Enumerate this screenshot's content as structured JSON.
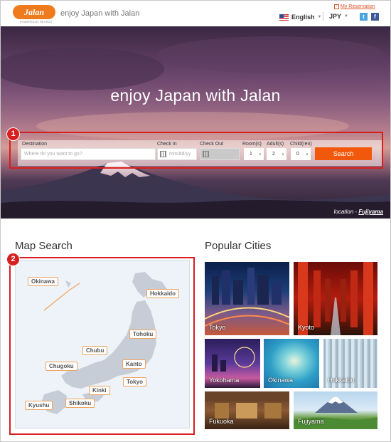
{
  "header": {
    "logo_text": "Jalan",
    "logo_sub": "POWERED BY RECRUIT",
    "tagline": "enjoy Japan with Jalan",
    "my_reservation": "My Reservation",
    "language": "English",
    "currency": "JPY",
    "social": {
      "twitter": "t",
      "facebook": "f"
    }
  },
  "hero": {
    "title": "enjoy Japan with Jalan",
    "location_prefix": "location - ",
    "location_name": "Fujiyama"
  },
  "search": {
    "destination_label": "Destination",
    "destination_placeholder": "Where do you want to go?",
    "checkin_label": "Check In",
    "checkin_placeholder": "mm/dd/yy",
    "checkout_label": "Check Out",
    "rooms_label": "Room(s)",
    "rooms_value": "1",
    "adults_label": "Adult(s)",
    "adults_value": "2",
    "children_label": "Child(ren)",
    "children_value": "0",
    "button": "Search"
  },
  "annotations": {
    "one": "1",
    "two": "2"
  },
  "map_search": {
    "title": "Map Search",
    "regions": [
      "Okinawa",
      "Hokkaido",
      "Tohoku",
      "Chubu",
      "Chugoku",
      "Kanto",
      "Tokyo",
      "Kinki",
      "Shikoku",
      "Kyushu"
    ]
  },
  "popular": {
    "title": "Popular Cities",
    "cities": [
      "Tokyo",
      "Kyoto",
      "Yokohama",
      "Okinawa",
      "Hokkaido",
      "Fukuoka",
      "Fujiyama"
    ]
  },
  "colors": {
    "brand": "#ef7b1f",
    "search_button": "#f2580c",
    "annotation": "#d81e1e"
  }
}
